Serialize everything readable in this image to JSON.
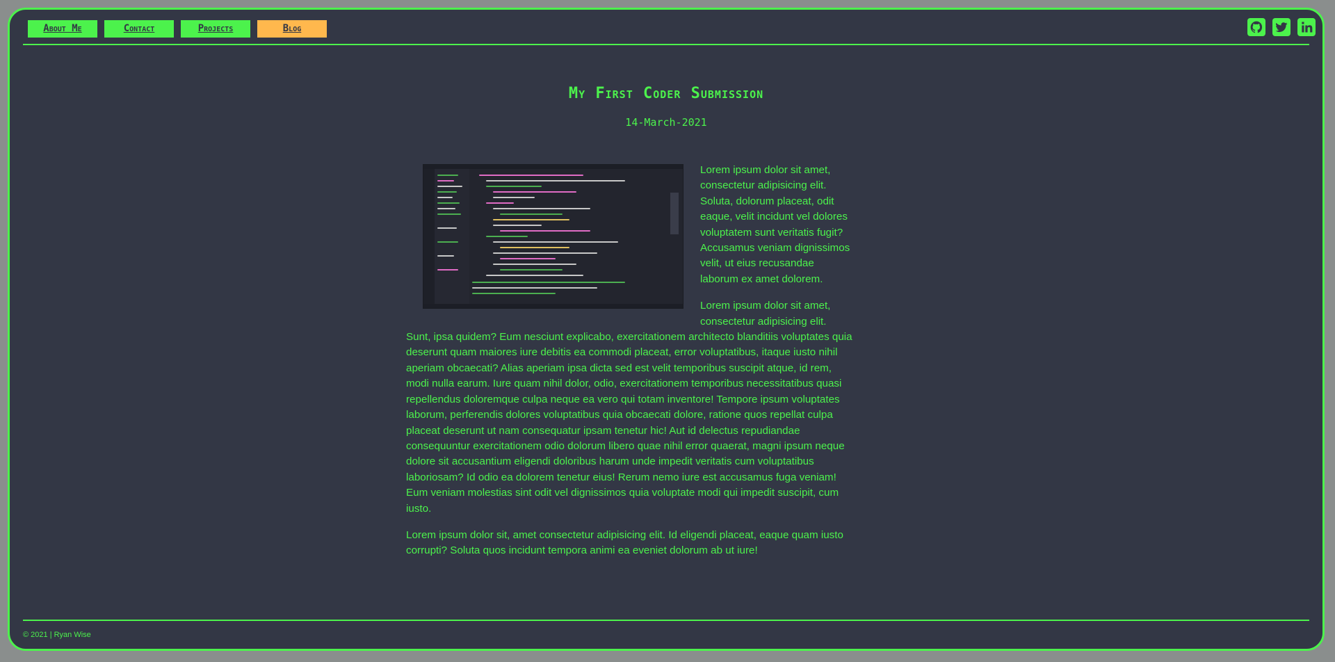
{
  "nav": {
    "items": [
      {
        "label": "About Me",
        "active": false
      },
      {
        "label": "Contact",
        "active": false
      },
      {
        "label": "Projects",
        "active": false
      },
      {
        "label": "Blog",
        "active": true
      }
    ]
  },
  "social": [
    "github-icon",
    "twitter-icon",
    "linkedin-icon"
  ],
  "post": {
    "title": "My First Coder Submission",
    "date": "14-March-2021",
    "paragraphs": [
      "Lorem ipsum dolor sit amet, consectetur adipisicing elit. Soluta, dolorum placeat, odit eaque, velit incidunt vel dolores voluptatem sunt veritatis fugit? Accusamus veniam dignissimos velit, ut eius recusandae laborum ex amet dolorem.",
      "Lorem ipsum dolor sit amet, consectetur adipisicing elit. Sunt, ipsa quidem? Eum nesciunt explicabo, exercitationem architecto blanditiis voluptates quia deserunt quam maiores iure debitis ea commodi placeat, error voluptatibus, itaque iusto nihil aperiam obcaecati? Alias aperiam ipsa dicta sed est velit temporibus suscipit atque, id rem, modi nulla earum. Iure quam nihil dolor, odio, exercitationem temporibus necessitatibus quasi repellendus doloremque culpa neque ea vero qui totam inventore! Tempore ipsum voluptates laborum, perferendis dolores voluptatibus quia obcaecati dolore, ratione quos repellat culpa placeat deserunt ut nam consequatur ipsam tenetur hic! Aut id delectus repudiandae consequuntur exercitationem odio dolorum libero quae nihil error quaerat, magni ipsum neque dolore sit accusantium eligendi doloribus harum unde impedit veritatis cum voluptatibus laboriosam? Id odio ea dolorem tenetur eius! Rerum nemo iure est accusamus fuga veniam! Eum veniam molestias sint odit vel dignissimos quia voluptate modi qui impedit suscipit, cum iusto.",
      "Lorem ipsum dolor sit, amet consectetur adipisicing elit. Id eligendi placeat, eaque quam iusto corrupti? Soluta quos incidunt tempora animi ea eveniet dolorum ab ut iure!"
    ]
  },
  "footer": {
    "text": "© 2021 | Ryan Wise"
  },
  "colors": {
    "accent": "#4cf24c",
    "active": "#ffb84d",
    "background": "#333745"
  }
}
